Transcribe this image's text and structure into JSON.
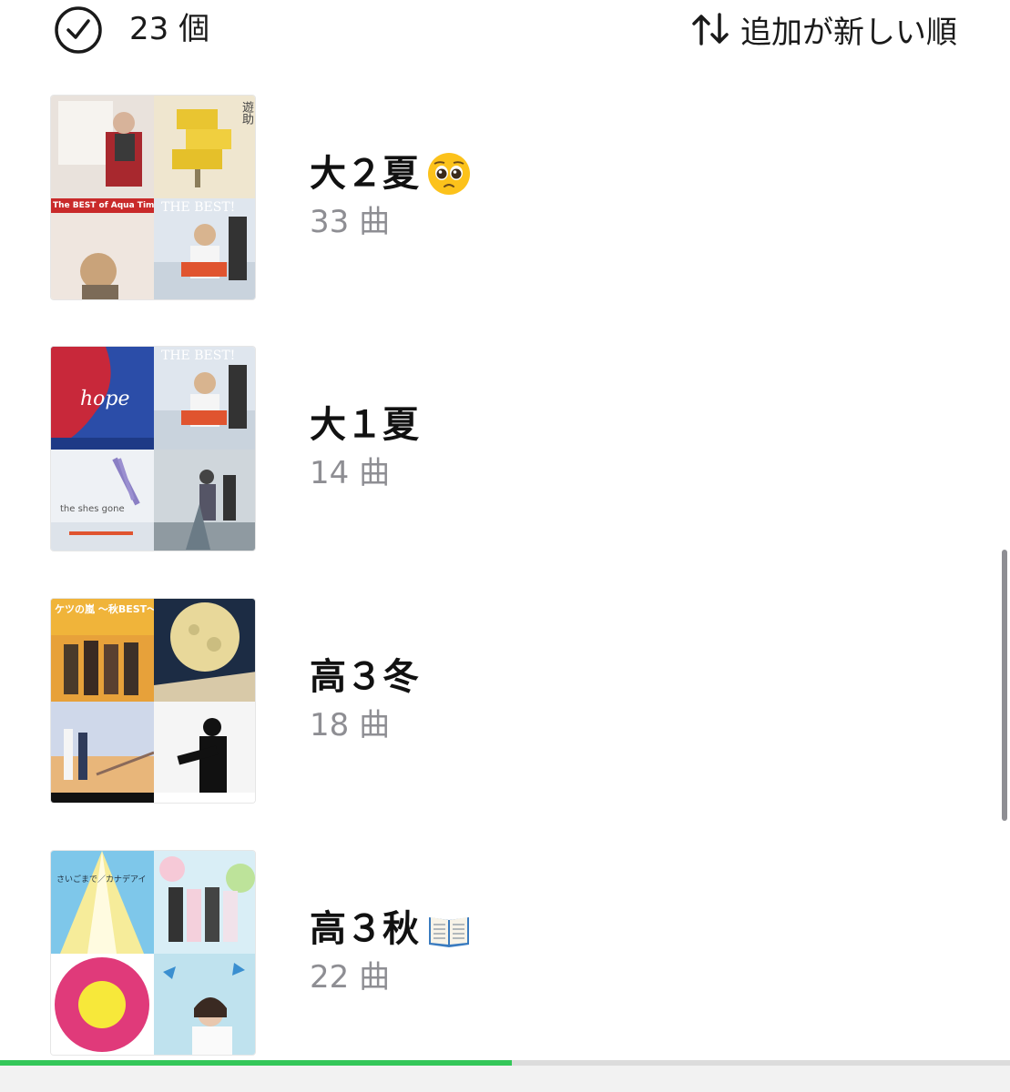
{
  "header": {
    "count_label": "23 個",
    "sort_label": "追加が新しい順",
    "icons": {
      "select": "check-circle-icon",
      "sort": "sort-arrows-icon"
    }
  },
  "playlists": [
    {
      "title": "大２夏",
      "emoji": "pleading-face-emoji",
      "songs": "33 曲",
      "covers": [
        {
          "text": ""
        },
        {
          "text": "遊助"
        },
        {
          "text": "The BEST of Aqua Timez"
        },
        {
          "text": "THE BEST!"
        }
      ]
    },
    {
      "title": "大１夏",
      "emoji": "",
      "songs": "14 曲",
      "covers": [
        {
          "text": "hope"
        },
        {
          "text": "THE BEST!"
        },
        {
          "text": "the shes gone"
        },
        {
          "text": ""
        }
      ]
    },
    {
      "title": "高３冬",
      "emoji": "",
      "songs": "18 曲",
      "covers": [
        {
          "text": "ケツの嵐 〜秋BEST〜"
        },
        {
          "text": ""
        },
        {
          "text": ""
        },
        {
          "text": ""
        }
      ]
    },
    {
      "title": "高３秋",
      "emoji": "open-book-emoji",
      "songs": "22 曲",
      "covers": [
        {
          "text": "さいごまで／カナデアイ"
        },
        {
          "text": ""
        },
        {
          "text": ""
        },
        {
          "text": ""
        }
      ]
    }
  ],
  "progress": {
    "fraction": 0.507
  },
  "colors": {
    "accent": "#34c759",
    "secondary_text": "#8e8e93"
  }
}
